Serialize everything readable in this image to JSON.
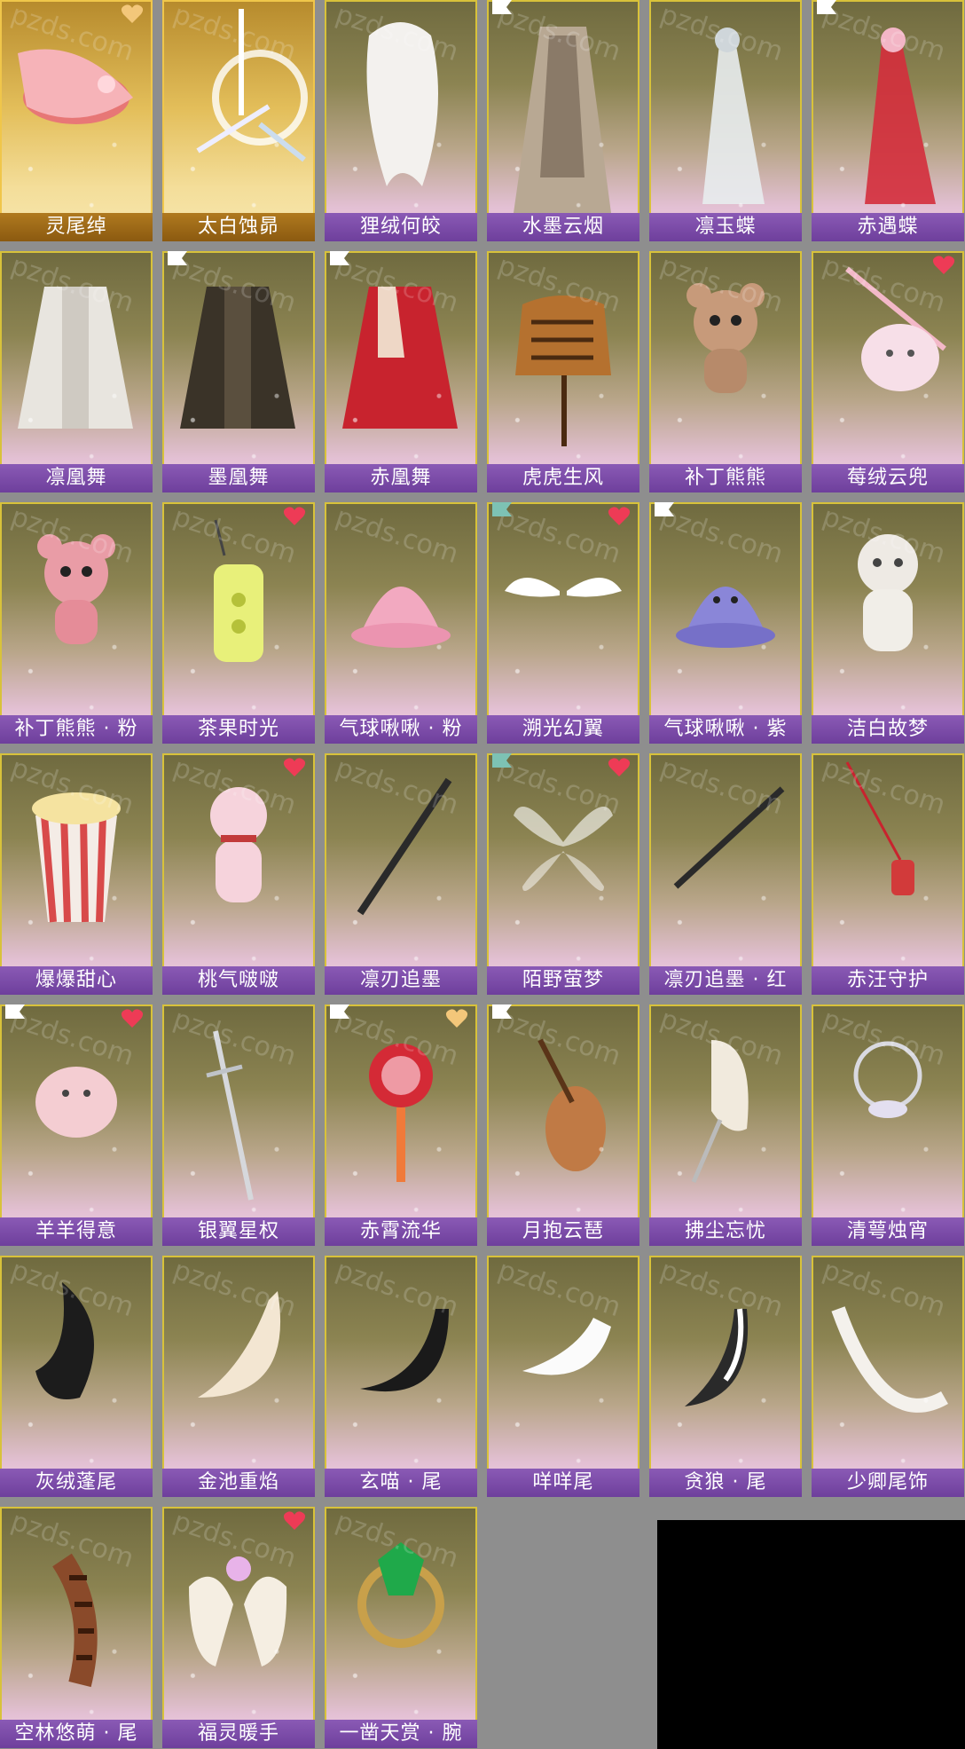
{
  "watermark": "pzds.com",
  "items": [
    {
      "name": "灵尾绰",
      "style": "gold",
      "heart": "gold",
      "art": "fox-spirit"
    },
    {
      "name": "太白蚀昴",
      "style": "gold",
      "art": "swords-moon"
    },
    {
      "name": "狸绒何皎",
      "art": "white-hair"
    },
    {
      "name": "水墨云烟",
      "tag": "white",
      "art": "ink-robe"
    },
    {
      "name": "凛玉蝶",
      "art": "white-dress"
    },
    {
      "name": "赤遇蝶",
      "tag": "white",
      "art": "red-dress"
    },
    {
      "name": "凛凰舞",
      "art": "white-feather-robe"
    },
    {
      "name": "墨凰舞",
      "tag": "white",
      "art": "black-feather-robe"
    },
    {
      "name": "赤凰舞",
      "tag": "white",
      "art": "red-robe"
    },
    {
      "name": "虎虎生风",
      "art": "tiger-coat"
    },
    {
      "name": "补丁熊熊",
      "art": "bear-brown"
    },
    {
      "name": "莓绒云兜",
      "heart": "red",
      "art": "bag-pink"
    },
    {
      "name": "补丁熊熊 · 粉",
      "art": "bear-pink"
    },
    {
      "name": "茶果时光",
      "heart": "red",
      "art": "lantern-jar"
    },
    {
      "name": "气球啾啾 · 粉",
      "art": "slime-pink"
    },
    {
      "name": "溯光幻翼",
      "tag": "green",
      "heart": "red",
      "art": "wings-white"
    },
    {
      "name": "气球啾啾 · 紫",
      "tag": "white",
      "art": "slime-purple"
    },
    {
      "name": "洁白故梦",
      "art": "cat-doll"
    },
    {
      "name": "爆爆甜心",
      "art": "popcorn"
    },
    {
      "name": "桃气啵啵",
      "heart": "red",
      "art": "pink-cat"
    },
    {
      "name": "凛刃追墨",
      "art": "black-sword"
    },
    {
      "name": "陌野萤梦",
      "tag": "green",
      "heart": "red",
      "art": "wings-clear"
    },
    {
      "name": "凛刃追墨 · 红",
      "art": "black-sword-2"
    },
    {
      "name": "赤汪守护",
      "art": "red-charm"
    },
    {
      "name": "羊羊得意",
      "tag": "white",
      "heart": "red",
      "art": "sheep"
    },
    {
      "name": "银翼星权",
      "art": "silver-sword"
    },
    {
      "name": "赤霄流华",
      "tag": "white",
      "heart": "gold",
      "art": "red-ornament"
    },
    {
      "name": "月抱云琶",
      "tag": "white",
      "art": "pipa"
    },
    {
      "name": "拂尘忘忧",
      "art": "whisk"
    },
    {
      "name": "清萼烛宵",
      "art": "moon-ring"
    },
    {
      "name": "灰绒蓬尾",
      "art": "tail-black"
    },
    {
      "name": "金池重焰",
      "art": "tail-cream"
    },
    {
      "name": "玄喵 · 尾",
      "art": "tail-cat"
    },
    {
      "name": "咩咩尾",
      "art": "tail-white"
    },
    {
      "name": "贪狼 · 尾",
      "art": "tail-wolf"
    },
    {
      "name": "少卿尾饰",
      "art": "tail-long"
    },
    {
      "name": "空林悠萌 · 尾",
      "art": "tail-raccoon"
    },
    {
      "name": "福灵暖手",
      "heart": "red",
      "art": "mittens"
    },
    {
      "name": "一凿天赏 · 腕",
      "art": "emerald-ring"
    }
  ]
}
